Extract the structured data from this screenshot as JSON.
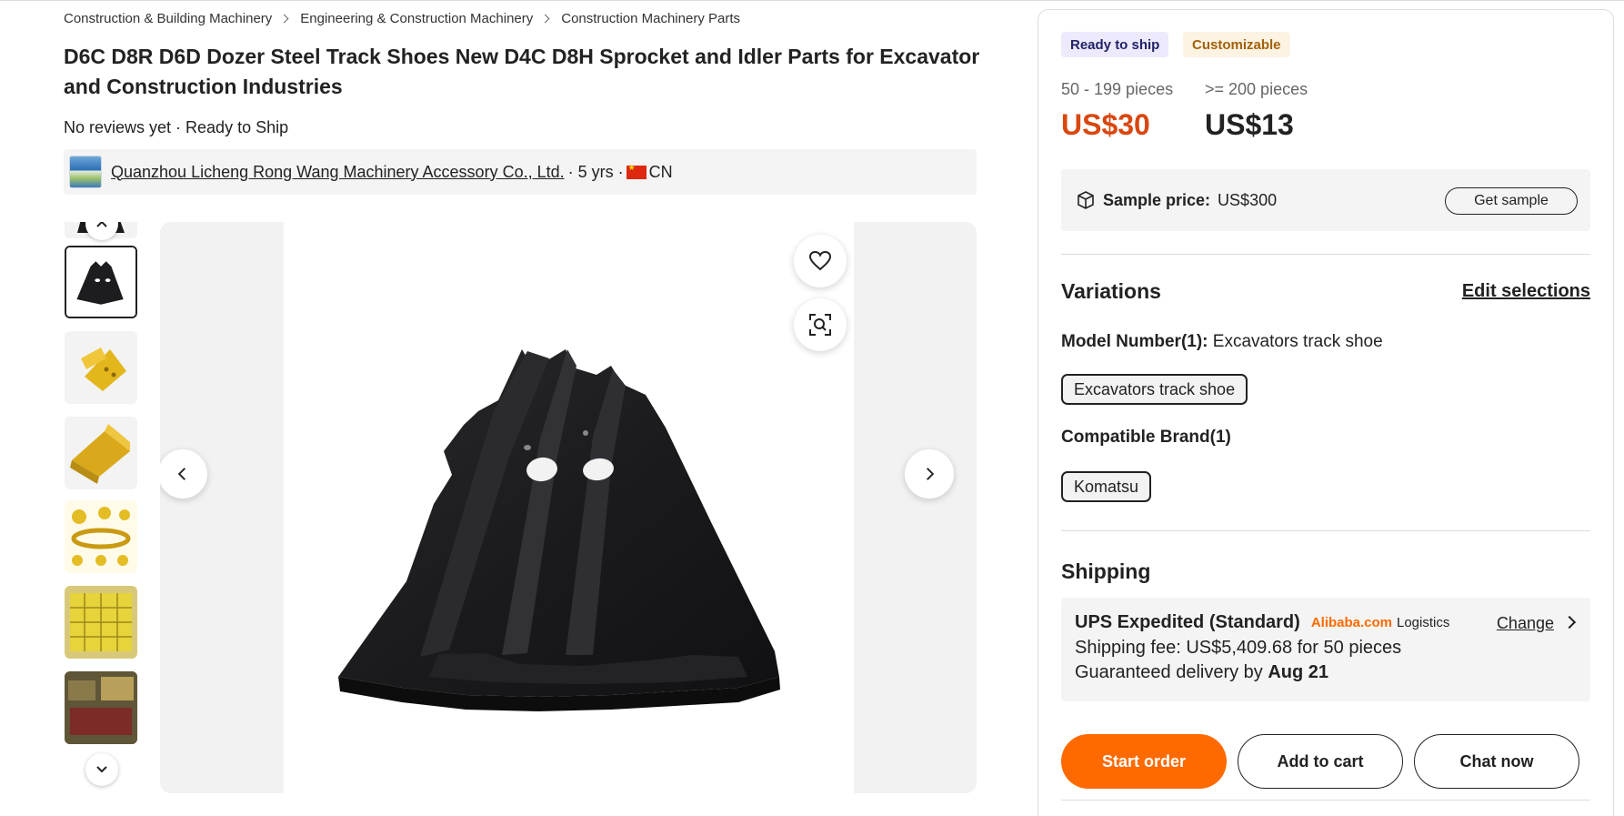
{
  "breadcrumb": [
    "Construction & Building Machinery",
    "Engineering & Construction Machinery",
    "Construction Machinery Parts"
  ],
  "product": {
    "title": "D6C D8R D6D Dozer Steel Track Shoes New D4C D8H Sprocket and Idler Parts for Excavator and Construction Industries",
    "reviews": "No reviews yet · Ready to Ship"
  },
  "supplier": {
    "name": "Quanzhou Licheng Rong Wang Machinery Accessory Co., Ltd.",
    "years": "· 5 yrs ·",
    "country": "CN"
  },
  "gallery": {
    "thumbnails": [
      "track-shoe-black",
      "yellow-bracket-1",
      "yellow-bracket-2",
      "yellow-parts-set",
      "yellow-crate",
      "parts-stack"
    ],
    "active_index": 1
  },
  "badges": {
    "ready": "Ready to ship",
    "custom": "Customizable"
  },
  "pricing": {
    "tiers": [
      {
        "qty": "50 - 199 pieces",
        "price": "US$30",
        "color": "#d9470f"
      },
      {
        "qty": ">= 200 pieces",
        "price": "US$13",
        "color": "#222222"
      }
    ]
  },
  "sample": {
    "label": "Sample price:",
    "price": "US$300",
    "button": "Get sample"
  },
  "variations": {
    "title": "Variations",
    "edit": "Edit selections",
    "model_label": "Model Number(1):",
    "model_value": "Excavators track shoe",
    "model_chip": "Excavators track shoe",
    "brand_label": "Compatible Brand(1)",
    "brand_chip": "Komatsu"
  },
  "shipping": {
    "title": "Shipping",
    "method": "UPS Expedited (Standard)",
    "brand": "Alibaba.com",
    "logistics": "Logistics",
    "change": "Change",
    "fee": "Shipping fee: US$5,409.68 for 50 pieces",
    "delivery_prefix": "Guaranteed delivery by",
    "delivery_date": "Aug 21"
  },
  "actions": {
    "start_order": "Start order",
    "add_to_cart": "Add to cart",
    "chat_now": "Chat now"
  },
  "colors": {
    "accent": "#ff6a00",
    "price_red": "#d9470f",
    "ready_bg": "#eceafc",
    "custom_text": "#a2610b"
  }
}
